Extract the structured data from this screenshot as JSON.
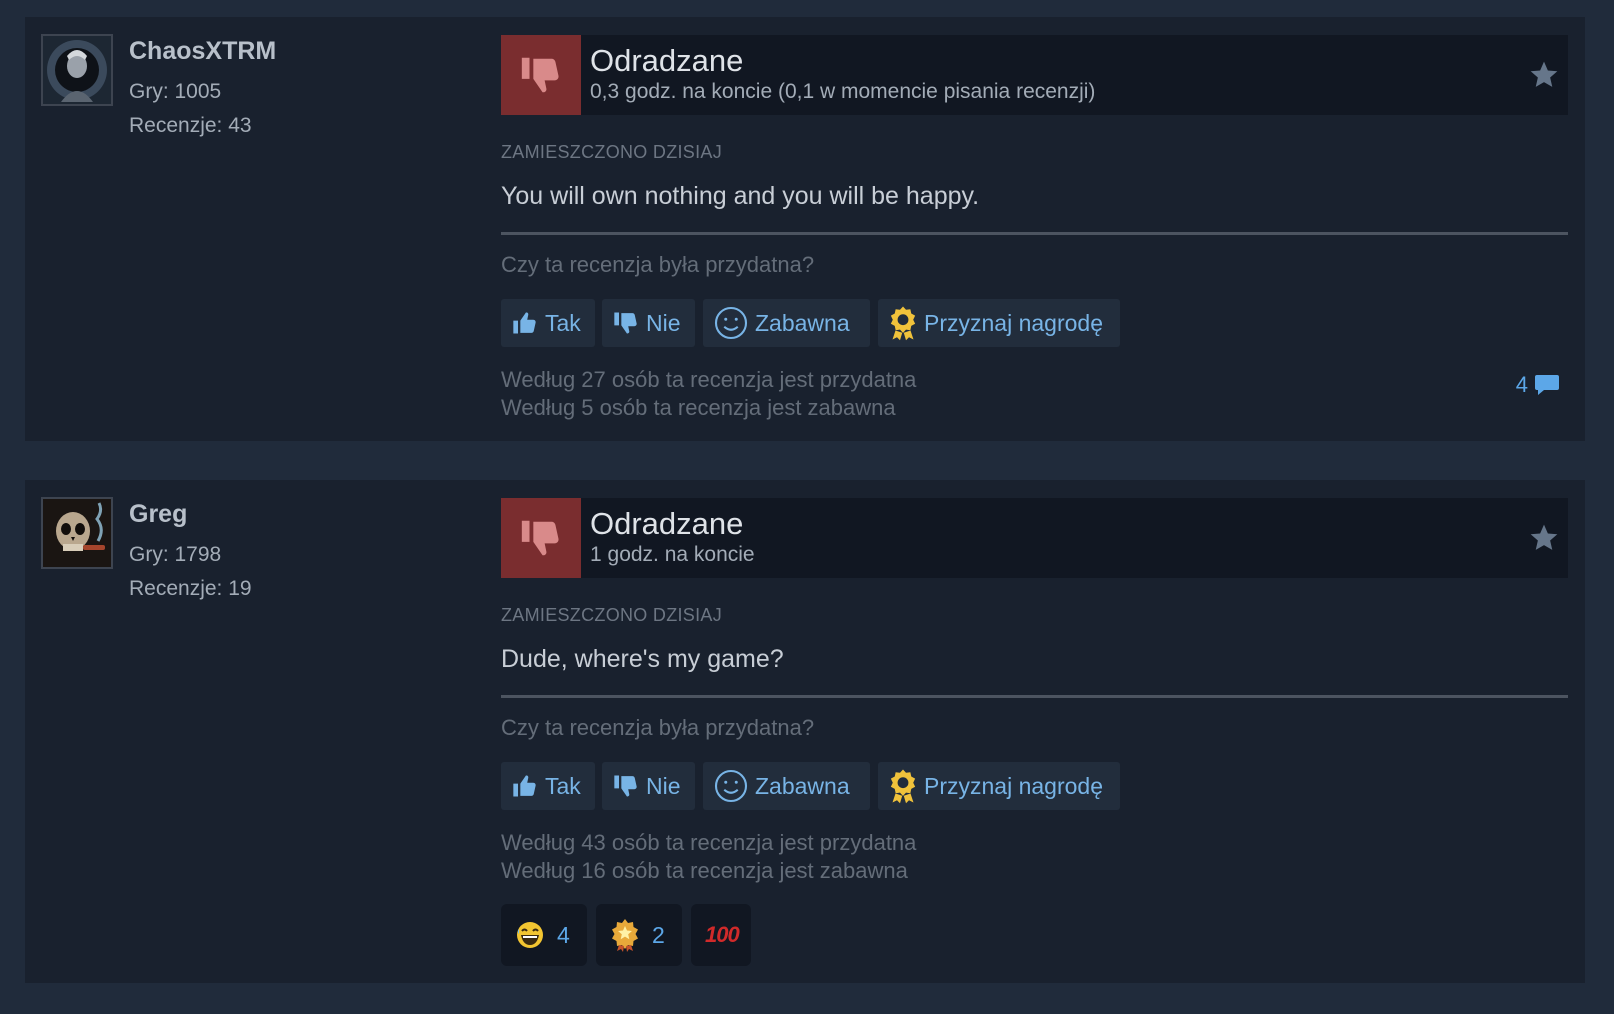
{
  "reviews": [
    {
      "username": "ChaosXTRM",
      "games": "Gry: 1005",
      "review_count": "Recenzje: 43",
      "verdict": "Odradzane",
      "hours": "0,3 godz. na koncie (0,1 w momencie pisania recenzji)",
      "posted": "ZAMIESZCZONO DZISIAJ",
      "text": "You will own nothing and you will be happy.",
      "question": "Czy ta recenzja była przydatna?",
      "buttons": {
        "yes": "Tak",
        "no": "Nie",
        "funny": "Zabawna",
        "award": "Przyznaj nagrodę"
      },
      "helpful_line": "Według 27 osób ta recenzja jest przydatna",
      "funny_line": "Według 5 osób ta recenzja jest zabawna",
      "comments": "4"
    },
    {
      "username": "Greg",
      "games": "Gry: 1798",
      "review_count": "Recenzje: 19",
      "verdict": "Odradzane",
      "hours": "1 godz. na koncie",
      "posted": "ZAMIESZCZONO DZISIAJ",
      "text": "Dude, where's my game?",
      "question": "Czy ta recenzja była przydatna?",
      "buttons": {
        "yes": "Tak",
        "no": "Nie",
        "funny": "Zabawna",
        "award": "Przyznaj nagrodę"
      },
      "helpful_line": "Według 43 osób ta recenzja jest przydatna",
      "funny_line": "Według 16 osób ta recenzja jest zabawna",
      "reactions": [
        {
          "icon": "laughing-face-icon",
          "count": "4"
        },
        {
          "icon": "golden-star-award-icon",
          "count": "2"
        },
        {
          "icon": "hundred-points-icon",
          "label": "100"
        }
      ]
    }
  ],
  "colors": {
    "page_bg": "#202b3b",
    "card_bg": "#19212e",
    "negative_thumb_bg": "#7a2d2f",
    "link_blue": "#78b4e6",
    "award_gold": "#f0c23b"
  }
}
